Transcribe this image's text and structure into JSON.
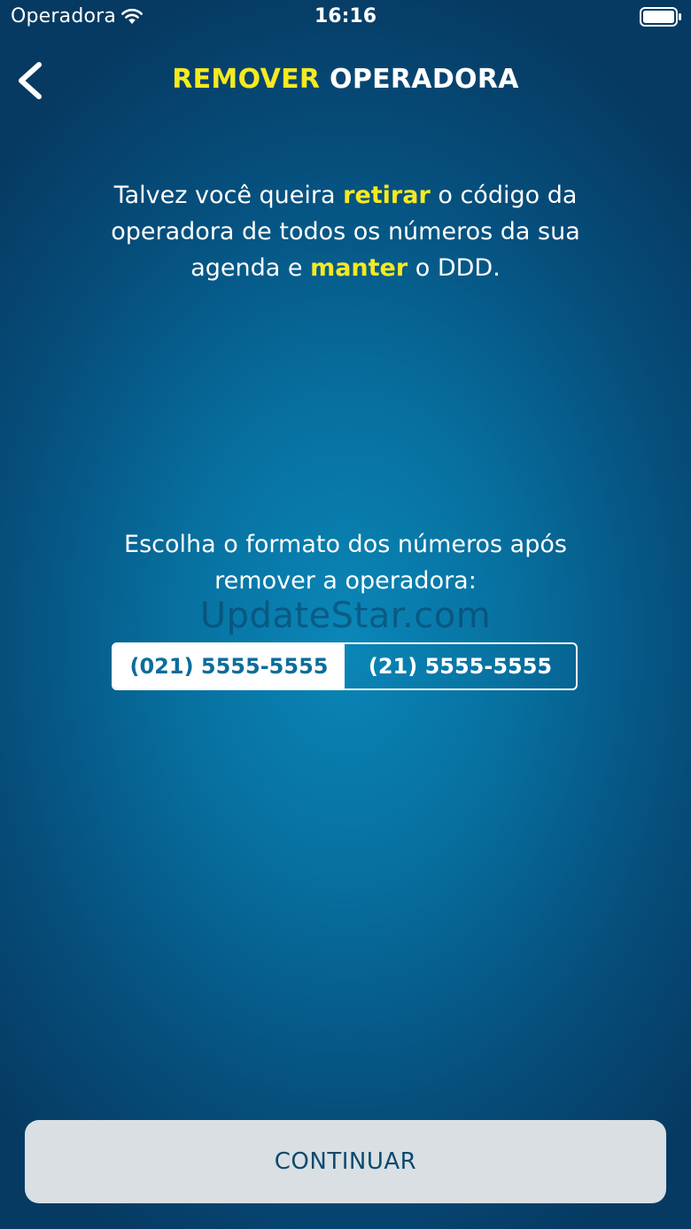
{
  "status_bar": {
    "carrier": "Operadora",
    "time": "16:16"
  },
  "nav": {
    "title_highlight": "REMOVER",
    "title_rest": " OPERADORA",
    "back_icon": "chevron-left-icon"
  },
  "intro": {
    "part1": "Talvez você queira ",
    "highlight1": "retirar",
    "part2": " o código da operadora de todos os números da sua agenda e ",
    "highlight2": "manter",
    "part3": " o DDD."
  },
  "format": {
    "prompt": "Escolha o formato dos números após remover a operadora:",
    "options": [
      {
        "label": "(021) 5555-5555",
        "selected": true
      },
      {
        "label": "(21) 5555-5555",
        "selected": false
      }
    ]
  },
  "watermark": "UpdateStar.com",
  "continue_label": "CONTINUAR",
  "colors": {
    "highlight": "#f6ea1f",
    "background": "#07709f",
    "selected_text": "#0b6d9c",
    "button_bg": "#d9dfe3",
    "button_text": "#0c4a6e"
  }
}
